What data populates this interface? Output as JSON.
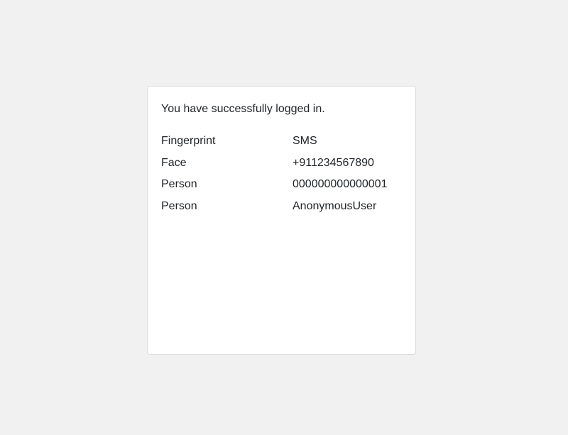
{
  "card": {
    "message": "You have successfully logged in.",
    "rows": [
      {
        "label": "Fingerprint",
        "value": "SMS"
      },
      {
        "label": "Face",
        "value": "+911234567890"
      },
      {
        "label": "Person",
        "value": "000000000000001"
      },
      {
        "label": "Person",
        "value": "AnonymousUser"
      }
    ]
  },
  "colors": {
    "background": "#f1f1f1",
    "card_background": "#ffffff",
    "card_border": "#dcdcdc",
    "text": "#212529"
  }
}
